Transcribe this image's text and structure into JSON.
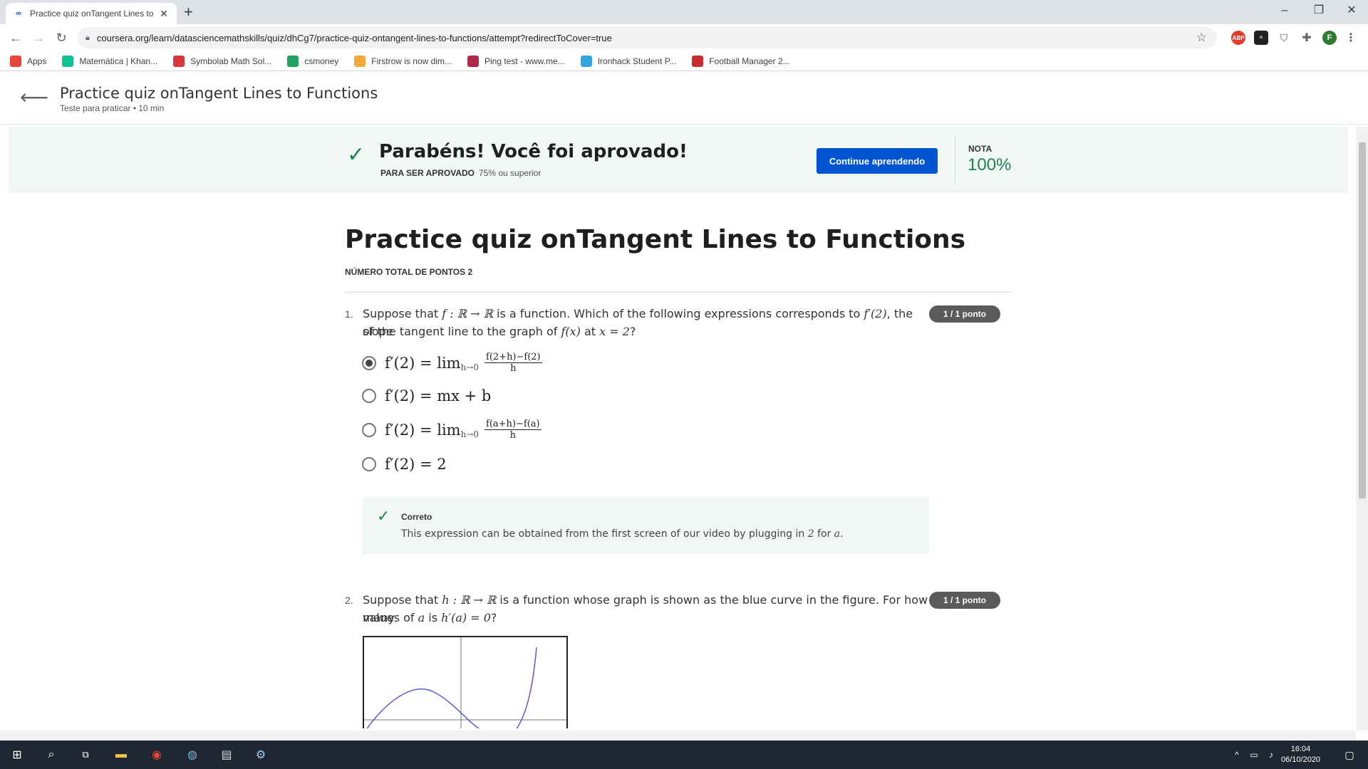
{
  "browser": {
    "tab_title": "Practice quiz onTangent Lines to",
    "url": "coursera.org/learn/datasciencemathskills/quiz/dhCg7/practice-quiz-ontangent-lines-to-functions/attempt?redirectToCover=true",
    "profile_initial": "F",
    "bookmarks": [
      {
        "label": "Apps",
        "icon": "apps-grid-icon",
        "color": "#e8453c"
      },
      {
        "label": "Matemática | Khan...",
        "icon": "khan-academy-icon",
        "color": "#14bf96"
      },
      {
        "label": "Symbolab Math Sol...",
        "icon": "symbolab-icon",
        "color": "#d9373e"
      },
      {
        "label": "csmoney",
        "icon": "csmoney-icon",
        "color": "#21a35f"
      },
      {
        "label": "Firstrow is now dim...",
        "icon": "firstrow-icon",
        "color": "#f2a93b"
      },
      {
        "label": "Ping test - www.me...",
        "icon": "ping-test-icon",
        "color": "#b02a4a"
      },
      {
        "label": "Ironhack Student P...",
        "icon": "ironhack-icon",
        "color": "#34a7e0"
      },
      {
        "label": "Football Manager 2...",
        "icon": "football-manager-icon",
        "color": "#c92c2c"
      }
    ],
    "extensions": [
      {
        "label": "ABP",
        "icon": "adblock-plus-icon",
        "color": "#e33d2d"
      },
      {
        "label": "^",
        "icon": "extension-dark-icon",
        "color": "#222222"
      },
      {
        "label": "",
        "icon": "shield-extension-icon",
        "color": "#bbbbbb"
      }
    ]
  },
  "header": {
    "title": "Practice quiz onTangent Lines to Functions",
    "subtitle": "Teste para praticar • 10 min"
  },
  "banner": {
    "title": "Parabéns! Você foi aprovado!",
    "pass_label": "PARA SER APROVADO",
    "pass_value": "75% ou superior",
    "continue_label": "Continue aprendendo",
    "grade_label": "NOTA",
    "grade_value": "100%",
    "accent_color": "#1f8354",
    "button_color": "#0056d2"
  },
  "quiz": {
    "title": "Practice quiz onTangent Lines to Functions",
    "total_points": "NÚMERO TOTAL DE PONTOS 2",
    "questions": [
      {
        "number": "1.",
        "text_line1_pre": "Suppose that",
        "text_line1_math1": "f : ℝ → ℝ",
        "text_line1_mid": "is a function. Which of the following expressions corresponds to",
        "text_line1_math2": "f′(2)",
        "text_line1_post": ", the slope",
        "text_line2_pre": "of the tangent line to the graph of",
        "text_line2_math1": "f(x)",
        "text_line2_mid": "at",
        "text_line2_math2": "x = 2",
        "text_line2_post": "?",
        "points": "1 / 1 ponto",
        "options": [
          {
            "lhs": "f′(2) = lim",
            "sub": "h→0",
            "num": "f(2+h)−f(2)",
            "den": "h",
            "selected": true
          },
          {
            "lhs": "f′(2) = mx + b",
            "selected": false
          },
          {
            "lhs": "f′(2) = lim",
            "sub": "h→0",
            "num": "f(a+h)−f(a)",
            "den": "h",
            "selected": false
          },
          {
            "lhs": "f′(2) = 2",
            "selected": false
          }
        ],
        "feedback": {
          "title": "Correto",
          "text_pre": "This expression can be obtained from the first screen of our video by plugging in",
          "math1": "2",
          "text_mid": "for",
          "math2": "a",
          "text_post": "."
        }
      },
      {
        "number": "2.",
        "text_line1_pre": "Suppose that",
        "text_line1_math1": "h : ℝ → ℝ",
        "text_line1_post": "is a function whose graph is shown as the blue curve in the figure. For how many",
        "text_line2_pre": "values of",
        "text_line2_math1": "a",
        "text_line2_mid": "is",
        "text_line2_math2": "h′(a) = 0",
        "text_line2_post": "?",
        "points": "1 / 1 ponto",
        "graph_curve_color": "#5a5ad8"
      }
    ]
  },
  "taskbar": {
    "time": "16:04",
    "date": "06/10/2020"
  }
}
